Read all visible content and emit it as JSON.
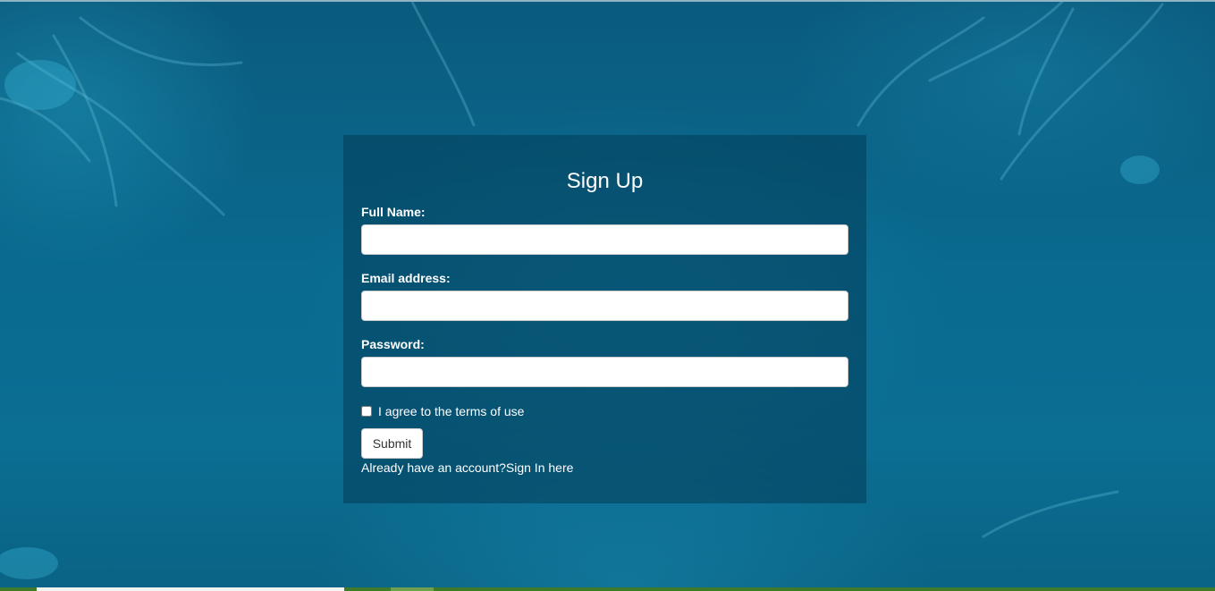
{
  "form": {
    "title": "Sign Up",
    "full_name": {
      "label": "Full Name:",
      "value": "",
      "placeholder": ""
    },
    "email": {
      "label": "Email address:",
      "value": "",
      "placeholder": ""
    },
    "password": {
      "label": "Password:",
      "value": "",
      "placeholder": ""
    },
    "terms": {
      "label": "I agree to the terms of use",
      "checked": false
    },
    "submit_label": "Submit",
    "signin_prompt": "Already have an account?",
    "signin_link": "Sign In here"
  },
  "colors": {
    "background": "#0a6488",
    "panel": "#033c58",
    "text": "#ffffff",
    "bottom_bar": "#3f7a2a"
  }
}
